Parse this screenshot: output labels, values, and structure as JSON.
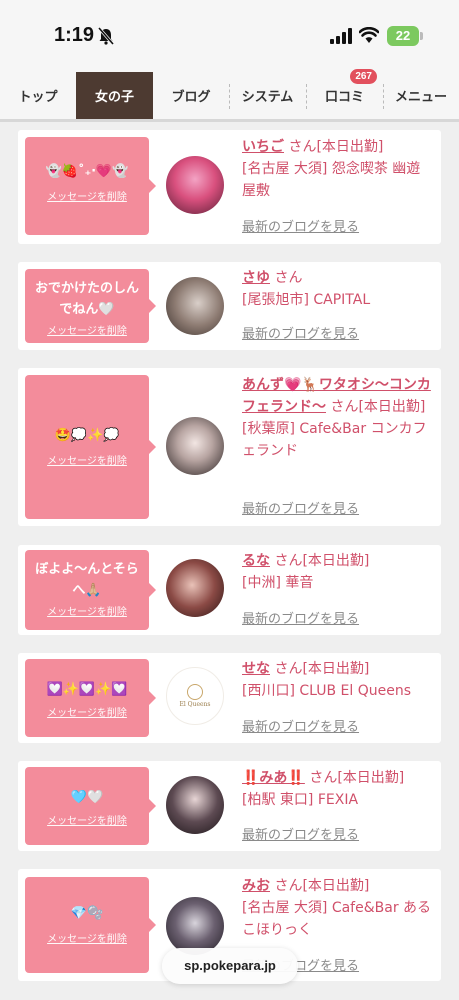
{
  "status_bar": {
    "time": "1:19",
    "battery": "22"
  },
  "tabs": [
    {
      "label": "トップ"
    },
    {
      "label": "女の子"
    },
    {
      "label": "ブログ"
    },
    {
      "label": "システム"
    },
    {
      "label": "口コミ",
      "badge": "267"
    },
    {
      "label": "メニュー"
    }
  ],
  "common": {
    "delete_label": "メッセージを削除",
    "blog_link": "最新のブログを見る",
    "san": "さん"
  },
  "cards": [
    {
      "message": "👻🍓˚₊‧💗👻",
      "name": "いちご",
      "status": "[本日出勤]",
      "location": "[名古屋 大須] 怨念喫茶 幽遊屋敷"
    },
    {
      "message": "おでかけたのしんでねん🤍",
      "name": "さゆ",
      "status": "",
      "location": "[尾張旭市] CAPITAL"
    },
    {
      "message": "🤩💭✨💭",
      "name": "あんず💗🦌ワタオシ〜コンカフェランド〜",
      "status": "[本日出勤]",
      "location": "[秋葉原] Cafe&Bar コンカフェランド"
    },
    {
      "message": "ぼよよ〜んとそらへ🙏🏼",
      "name": "るな",
      "status": "[本日出勤]",
      "location": "[中洲] 華音"
    },
    {
      "message": "💟✨💟✨💟",
      "name": "せな",
      "status": "[本日出勤]",
      "location": "[西川口] CLUB El Queens"
    },
    {
      "message": "🩵🤍",
      "name": "‼️みあ‼️",
      "status": "[本日出勤]",
      "location": "[柏駅 東口] FEXIA"
    },
    {
      "message": "💎🫧",
      "name": "みお",
      "status": "[本日出勤]",
      "location": "[名古屋 大須] Cafe&Bar あるこほりっく"
    }
  ],
  "avatar_logo_text": "El Queens",
  "url": "sp.pokepara.jp"
}
